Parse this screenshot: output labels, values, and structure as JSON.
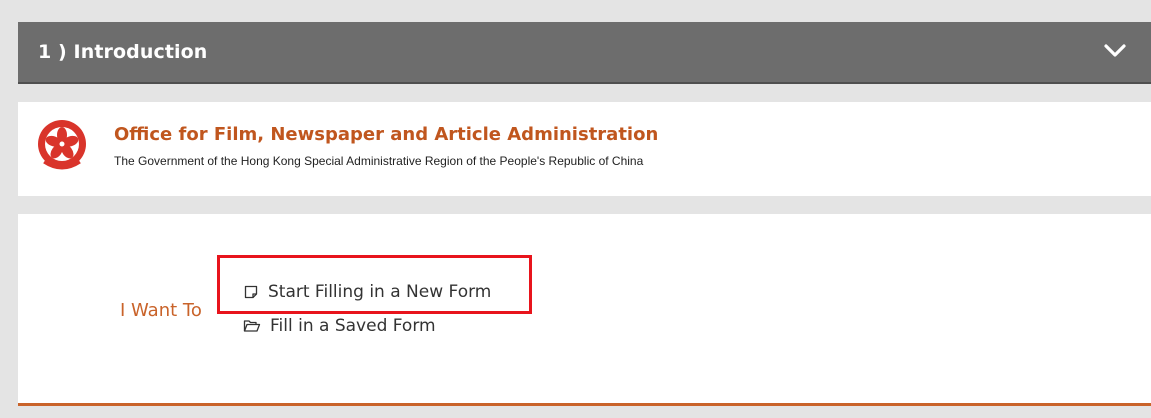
{
  "section": {
    "title": "1 ) Introduction",
    "toggle_icon": "chevron-down-icon"
  },
  "agency": {
    "emblem": "hksar-regional-emblem",
    "name": "Office for Film, Newspaper and Article Administration",
    "subtitle": "The Government of the Hong Kong Special Administrative Region of the People's Republic of China"
  },
  "actions": {
    "label": "I Want To",
    "options": [
      {
        "label": "Start Filling in a New Form",
        "icon": "note-icon",
        "highlighted": true
      },
      {
        "label": "Fill in a Saved Form",
        "icon": "folder-open-icon",
        "highlighted": false
      }
    ]
  },
  "colors": {
    "header_bg": "#6d6d6d",
    "accent_orange": "#c9632a",
    "highlight_red": "#e8141c",
    "page_bg": "#e4e4e4"
  }
}
